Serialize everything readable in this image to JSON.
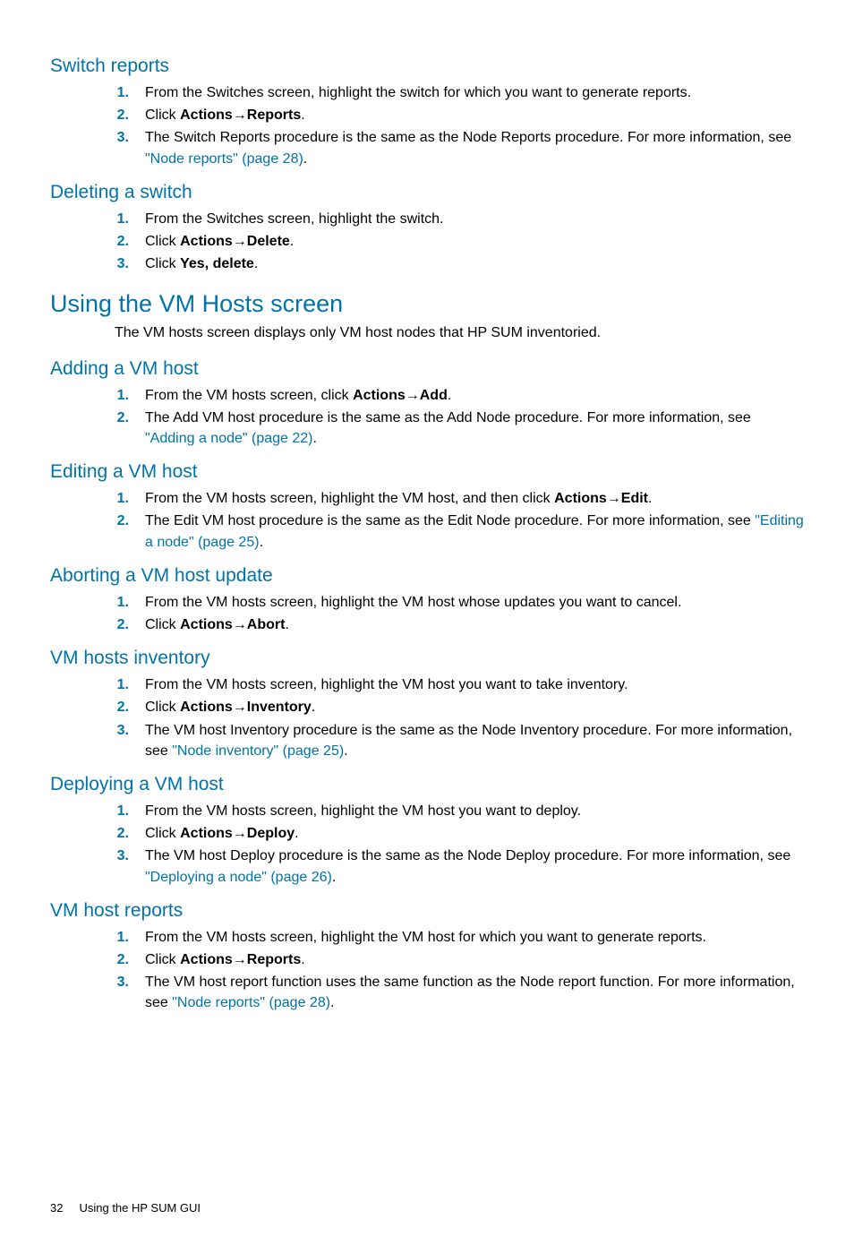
{
  "sections": [
    {
      "level": "h2",
      "title": "Switch reports",
      "steps": [
        [
          {
            "t": "text",
            "v": "From the Switches screen, highlight the switch for which you want to generate reports."
          }
        ],
        [
          {
            "t": "text",
            "v": "Click "
          },
          {
            "t": "bold",
            "v": "Actions"
          },
          {
            "t": "text",
            "v": "→"
          },
          {
            "t": "bold",
            "v": "Reports"
          },
          {
            "t": "text",
            "v": "."
          }
        ],
        [
          {
            "t": "text",
            "v": "The Switch Reports procedure is the same as the Node Reports procedure. For more information, see "
          },
          {
            "t": "link",
            "v": "\"Node reports\" (page 28)"
          },
          {
            "t": "text",
            "v": "."
          }
        ]
      ]
    },
    {
      "level": "h2",
      "title": "Deleting a switch",
      "steps": [
        [
          {
            "t": "text",
            "v": "From the Switches screen, highlight the switch."
          }
        ],
        [
          {
            "t": "text",
            "v": "Click "
          },
          {
            "t": "bold",
            "v": "Actions"
          },
          {
            "t": "text",
            "v": "→"
          },
          {
            "t": "bold",
            "v": "Delete"
          },
          {
            "t": "text",
            "v": "."
          }
        ],
        [
          {
            "t": "text",
            "v": "Click "
          },
          {
            "t": "bold",
            "v": "Yes, delete"
          },
          {
            "t": "text",
            "v": "."
          }
        ]
      ]
    },
    {
      "level": "h1",
      "title": "Using the VM Hosts screen",
      "intro": "The VM hosts screen displays only VM host nodes that HP SUM inventoried."
    },
    {
      "level": "h2",
      "title": "Adding a VM host",
      "steps": [
        [
          {
            "t": "text",
            "v": "From the VM hosts screen, click "
          },
          {
            "t": "bold",
            "v": "Actions"
          },
          {
            "t": "text",
            "v": "→"
          },
          {
            "t": "bold",
            "v": "Add"
          },
          {
            "t": "text",
            "v": "."
          }
        ],
        [
          {
            "t": "text",
            "v": "The Add VM host procedure is the same as the Add Node procedure. For more information, see "
          },
          {
            "t": "link",
            "v": "\"Adding a node\" (page 22)"
          },
          {
            "t": "text",
            "v": "."
          }
        ]
      ]
    },
    {
      "level": "h2",
      "title": "Editing a VM host",
      "steps": [
        [
          {
            "t": "text",
            "v": "From the VM hosts screen, highlight the VM host, and then click "
          },
          {
            "t": "bold",
            "v": "Actions"
          },
          {
            "t": "text",
            "v": "→"
          },
          {
            "t": "bold",
            "v": "Edit"
          },
          {
            "t": "text",
            "v": "."
          }
        ],
        [
          {
            "t": "text",
            "v": "The Edit VM host procedure is the same as the Edit Node procedure. For more information, see "
          },
          {
            "t": "link",
            "v": "\"Editing a node\" (page 25)"
          },
          {
            "t": "text",
            "v": "."
          }
        ]
      ]
    },
    {
      "level": "h2",
      "title": "Aborting a VM host update",
      "steps": [
        [
          {
            "t": "text",
            "v": "From the VM hosts screen, highlight the VM host whose updates you want to cancel."
          }
        ],
        [
          {
            "t": "text",
            "v": "Click "
          },
          {
            "t": "bold",
            "v": "Actions"
          },
          {
            "t": "text",
            "v": "→"
          },
          {
            "t": "bold",
            "v": "Abort"
          },
          {
            "t": "text",
            "v": "."
          }
        ]
      ]
    },
    {
      "level": "h2",
      "title": "VM hosts inventory",
      "steps": [
        [
          {
            "t": "text",
            "v": "From the VM hosts screen, highlight the VM host you want to take inventory."
          }
        ],
        [
          {
            "t": "text",
            "v": "Click "
          },
          {
            "t": "bold",
            "v": "Actions"
          },
          {
            "t": "text",
            "v": "→"
          },
          {
            "t": "bold",
            "v": "Inventory"
          },
          {
            "t": "text",
            "v": "."
          }
        ],
        [
          {
            "t": "text",
            "v": "The VM host Inventory procedure is the same as the Node Inventory procedure. For more information, see "
          },
          {
            "t": "link",
            "v": "\"Node inventory\" (page 25)"
          },
          {
            "t": "text",
            "v": "."
          }
        ]
      ]
    },
    {
      "level": "h2",
      "title": "Deploying a VM host",
      "steps": [
        [
          {
            "t": "text",
            "v": "From the VM hosts screen, highlight the VM host you want to deploy."
          }
        ],
        [
          {
            "t": "text",
            "v": "Click "
          },
          {
            "t": "bold",
            "v": "Actions"
          },
          {
            "t": "text",
            "v": "→"
          },
          {
            "t": "bold",
            "v": "Deploy"
          },
          {
            "t": "text",
            "v": "."
          }
        ],
        [
          {
            "t": "text",
            "v": "The VM host Deploy procedure is the same as the Node Deploy procedure. For more information, see "
          },
          {
            "t": "link",
            "v": "\"Deploying a node\" (page 26)"
          },
          {
            "t": "text",
            "v": "."
          }
        ]
      ]
    },
    {
      "level": "h2",
      "title": "VM host reports",
      "steps": [
        [
          {
            "t": "text",
            "v": "From the VM hosts screen, highlight the VM host for which you want to generate reports."
          }
        ],
        [
          {
            "t": "text",
            "v": "Click "
          },
          {
            "t": "bold",
            "v": "Actions"
          },
          {
            "t": "text",
            "v": "→"
          },
          {
            "t": "bold",
            "v": "Reports"
          },
          {
            "t": "text",
            "v": "."
          }
        ],
        [
          {
            "t": "text",
            "v": "The VM host report function uses the same function as the Node report function. For more information, see "
          },
          {
            "t": "link",
            "v": "\"Node reports\" (page 28)"
          },
          {
            "t": "text",
            "v": "."
          }
        ]
      ]
    }
  ],
  "footer": {
    "page": "32",
    "chapter": "Using the HP SUM GUI"
  }
}
